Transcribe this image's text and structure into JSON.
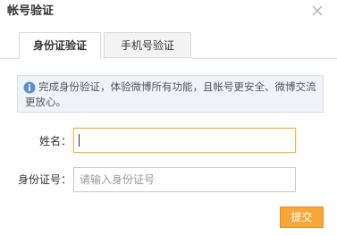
{
  "dialog": {
    "title": "帐号验证"
  },
  "tabs": [
    {
      "label": "身份证验证",
      "active": true
    },
    {
      "label": "手机号验证",
      "active": false
    }
  ],
  "notice": {
    "icon": "info-icon",
    "text": "完成身份验证，体验微博所有功能，且帐号更安全、微博交流更放心。"
  },
  "form": {
    "name_label": "姓名：",
    "name_value": "",
    "id_label": "身份证号：",
    "id_placeholder": "请输入身份证号",
    "id_value": ""
  },
  "actions": {
    "submit_label": "提交"
  },
  "colors": {
    "accent": "#f7a73a",
    "focus_border": "#f0b84a",
    "notice_bg": "#f0f4f8",
    "info_icon": "#5b8fc7"
  }
}
